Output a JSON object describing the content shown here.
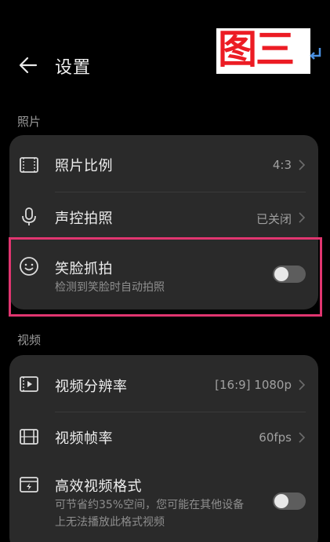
{
  "header": {
    "title": "设置",
    "back_icon": "arrow-left-icon"
  },
  "watermark": {
    "text": "图三",
    "color": "#ec1c24",
    "mark_icon": "return-arrow-icon"
  },
  "sections": {
    "photo": {
      "label": "照片",
      "items": {
        "aspect_ratio": {
          "label": "照片比例",
          "value": "4:3",
          "icon": "frame-icon"
        },
        "voice_shot": {
          "label": "声控拍照",
          "value": "已关闭",
          "icon": "microphone-icon"
        },
        "smile_capture": {
          "label": "笑脸抓拍",
          "sub": "检测到笑脸时自动拍照",
          "icon": "smile-icon",
          "toggle_on": false
        }
      }
    },
    "video": {
      "label": "视频",
      "items": {
        "resolution": {
          "label": "视频分辨率",
          "value": "[16:9] 1080p",
          "icon": "video-resolution-icon"
        },
        "frame_rate": {
          "label": "视频帧率",
          "value": "60fps",
          "icon": "film-strip-icon"
        },
        "efficient_format": {
          "label": "高效视频格式",
          "sub": "可节省约35%空间，您可能在其他设备上无法播放此格式视频",
          "icon": "video-format-icon",
          "toggle_on": false
        }
      }
    }
  },
  "colors": {
    "background": "#000000",
    "card": "#2a2a2a",
    "highlight": "#e0356f",
    "toggle_off": "#5d5d5d"
  }
}
